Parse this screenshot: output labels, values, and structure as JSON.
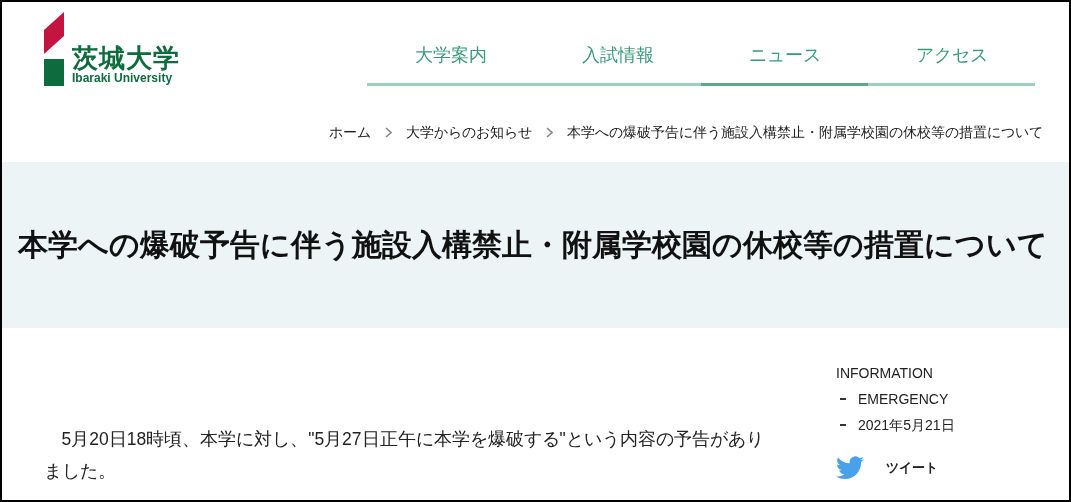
{
  "logo": {
    "name": "茨城大学",
    "subtitle": "Ibaraki University"
  },
  "nav": [
    {
      "label": "大学案内",
      "selected": false
    },
    {
      "label": "入試情報",
      "selected": false
    },
    {
      "label": "ニュース",
      "selected": true
    },
    {
      "label": "アクセス",
      "selected": false
    }
  ],
  "breadcrumb": [
    "ホーム",
    "大学からのお知らせ",
    "本学への爆破予告に伴う施設入構禁止・附属学校園の休校等の措置について"
  ],
  "title": "本学への爆破予告に伴う施設入構禁止・附属学校園の休校等の措置について",
  "body": [
    "5月20日18時頃、本学に対し、\"5月27日正午に本学を爆破する\"という内容の予告がありました。"
  ],
  "sidebar": {
    "heading": "INFORMATION",
    "items": [
      "EMERGENCY",
      "2021年5月21日"
    ],
    "tweet": "ツイート"
  }
}
